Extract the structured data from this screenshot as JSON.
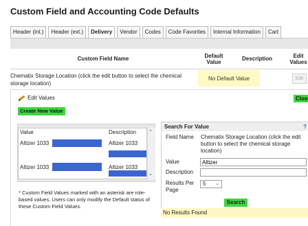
{
  "page": {
    "title": "Custom Field and Accounting Code Defaults"
  },
  "tabs": [
    {
      "label": "Header (int.)"
    },
    {
      "label": "Header (ext.)"
    },
    {
      "label": "Delivery",
      "active": true
    },
    {
      "label": "Vendor"
    },
    {
      "label": "Codes"
    },
    {
      "label": "Code Favorites"
    },
    {
      "label": "Internal Information"
    },
    {
      "label": "Cart"
    }
  ],
  "table": {
    "headers": {
      "name": "Custom Field Name",
      "default_value": "Default Value",
      "description": "Description",
      "edit_values": "Edit Values"
    },
    "row": {
      "name": "Chematix Storage Location (click the edit button to select the chemical storage location)",
      "default_value": "No Default Value",
      "edit_label": "Edit"
    }
  },
  "edit_panel": {
    "title": "Edit Values",
    "close_label": "Close",
    "create_label": "Create New Value",
    "values_list": {
      "col_value": "Value",
      "col_description": "Description",
      "rows": [
        {
          "value": "Altizer 1033",
          "description": "Altizer 1033"
        },
        {
          "value": "Altizer 1033",
          "description": "Altizer 1033"
        }
      ]
    },
    "footnote": "* Custom Field Values marked with an asterisk are role-based values. Users can only modify the Default status of these Custom Field Values."
  },
  "search": {
    "title": "Search For Value",
    "help": "?",
    "field_name_label": "Field Name",
    "field_name_value": "Chematix Storage Location (click the edit button to select the chemical storage location)",
    "value_label": "Value",
    "value_input": "Altizer",
    "description_label": "Description",
    "description_input": "",
    "results_per_page_label": "Results Per Page",
    "results_per_page_value": "5",
    "search_label": "Search",
    "no_results": "No Results Found"
  },
  "colors": {
    "green_button": "#3ed63e",
    "redaction_blue": "#3b66cf",
    "yellow_highlight": "#fff9c4"
  }
}
